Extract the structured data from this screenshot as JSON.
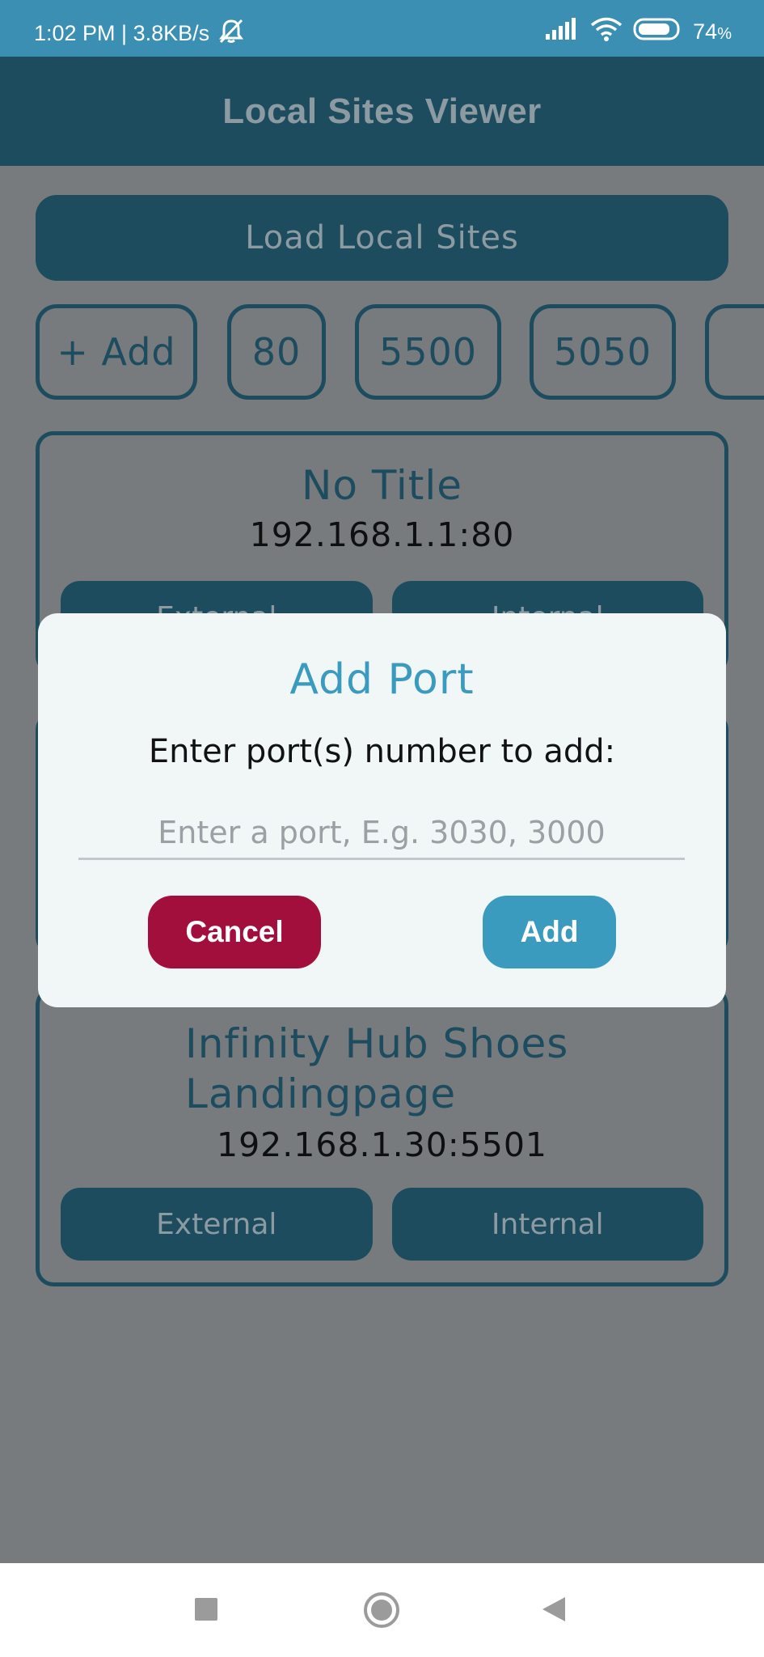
{
  "status_bar": {
    "time_speed": "1:02 PM | 3.8KB/s",
    "battery": "74",
    "battery_unit": "%",
    "icons": [
      "mute-icon",
      "signal-icon",
      "wifi-icon",
      "battery-icon"
    ]
  },
  "app_bar": {
    "title": "Local Sites Viewer"
  },
  "main": {
    "load_button": "Load Local Sites",
    "port_chips": [
      "+ Add",
      "80",
      "5500",
      "5050",
      ""
    ],
    "sites": [
      {
        "title": "No Title",
        "address": "192.168.1.1:80",
        "external": "External",
        "internal": "Internal"
      },
      {
        "title": "Infinity Hub Shoes\nLandingpage",
        "address": "192.168.1.30:5501",
        "external": "External",
        "internal": "Internal"
      }
    ]
  },
  "dialog": {
    "title": "Add Port",
    "message": "Enter port(s) number to add:",
    "input_value": "",
    "input_placeholder": "Enter a port, E.g. 3030, 3000",
    "cancel_label": "Cancel",
    "add_label": "Add"
  },
  "colors": {
    "status_bar": "#3a8fb2",
    "primary_dark": "#1d4c5f",
    "accent": "#3a9bbf",
    "cancel": "#a20f3c",
    "scrim_bg": "#777b7d"
  },
  "nav_bar": {
    "icons": [
      "recents-square-icon",
      "home-circle-icon",
      "back-triangle-icon"
    ]
  }
}
